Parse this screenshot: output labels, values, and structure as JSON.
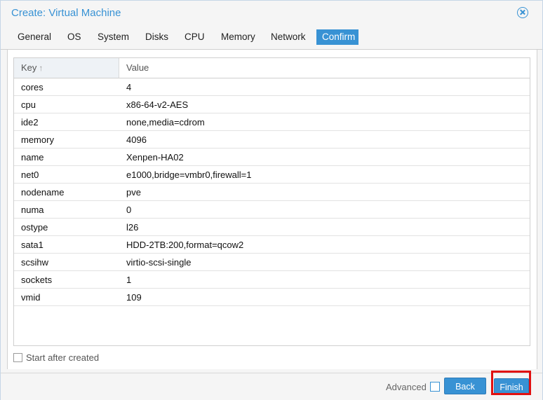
{
  "dialog": {
    "title": "Create: Virtual Machine"
  },
  "tabs": [
    {
      "label": "General"
    },
    {
      "label": "OS"
    },
    {
      "label": "System"
    },
    {
      "label": "Disks"
    },
    {
      "label": "CPU"
    },
    {
      "label": "Memory"
    },
    {
      "label": "Network"
    },
    {
      "label": "Confirm",
      "active": true
    }
  ],
  "grid": {
    "columns": {
      "key": "Key",
      "value": "Value"
    },
    "sort_icon": "arrow-up-icon",
    "rows": [
      {
        "key": "cores",
        "value": "4"
      },
      {
        "key": "cpu",
        "value": "x86-64-v2-AES"
      },
      {
        "key": "ide2",
        "value": "none,media=cdrom"
      },
      {
        "key": "memory",
        "value": "4096"
      },
      {
        "key": "name",
        "value": "Xenpen-HA02"
      },
      {
        "key": "net0",
        "value": "e1000,bridge=vmbr0,firewall=1"
      },
      {
        "key": "nodename",
        "value": "pve"
      },
      {
        "key": "numa",
        "value": "0"
      },
      {
        "key": "ostype",
        "value": "l26"
      },
      {
        "key": "sata1",
        "value": "HDD-2TB:200,format=qcow2"
      },
      {
        "key": "scsihw",
        "value": "virtio-scsi-single"
      },
      {
        "key": "sockets",
        "value": "1"
      },
      {
        "key": "vmid",
        "value": "109"
      }
    ]
  },
  "start_after_created": {
    "label": "Start after created",
    "checked": false
  },
  "footer": {
    "advanced_label": "Advanced",
    "advanced_checked": false,
    "back_label": "Back",
    "finish_label": "Finish"
  },
  "colors": {
    "accent": "#3892d4",
    "highlight": "#e11010"
  }
}
